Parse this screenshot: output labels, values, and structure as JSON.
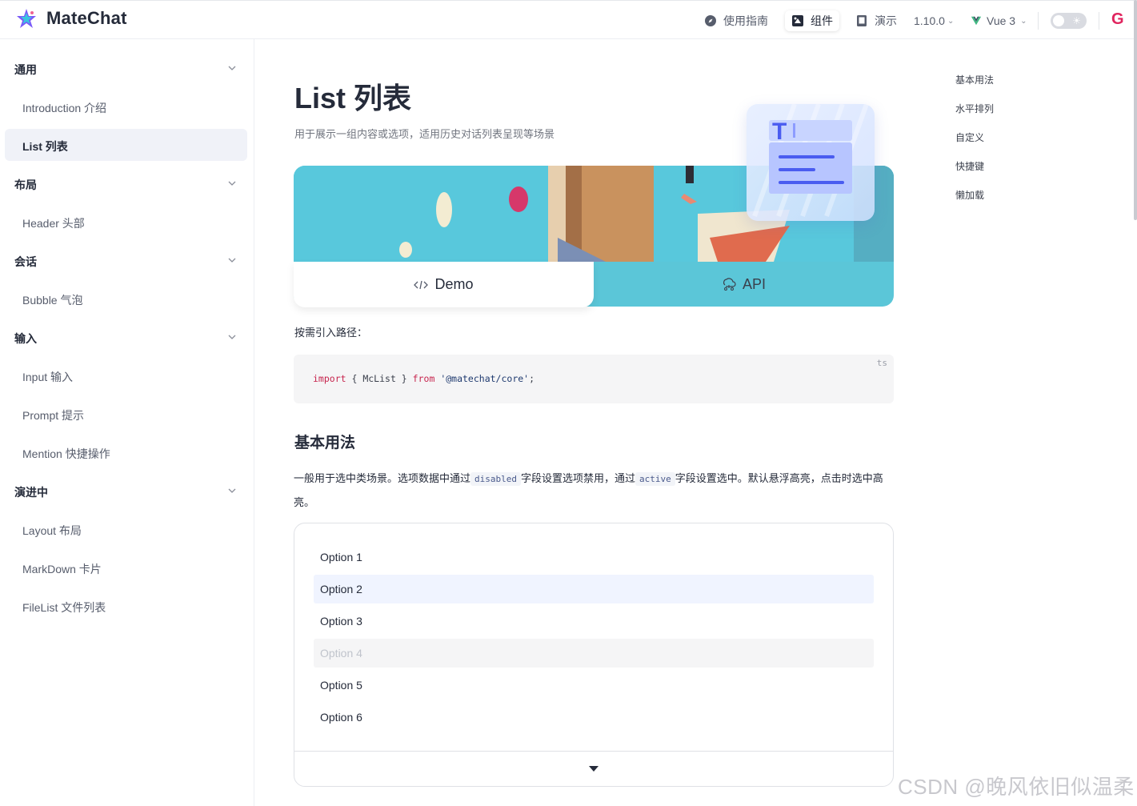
{
  "header": {
    "brand": "MateChat",
    "nav": [
      {
        "label": "使用指南",
        "icon": "compass-icon"
      },
      {
        "label": "组件",
        "icon": "component-icon",
        "active": true
      },
      {
        "label": "演示",
        "icon": "book-icon"
      }
    ],
    "version": "1.10.0",
    "framework": "Vue 3",
    "accent": "#5e7ce0"
  },
  "sidebar": {
    "groups": [
      {
        "label": "通用",
        "items": [
          "Introduction 介绍",
          "List 列表"
        ]
      },
      {
        "label": "布局",
        "items": [
          "Header 头部"
        ]
      },
      {
        "label": "会话",
        "items": [
          "Bubble 气泡"
        ]
      },
      {
        "label": "输入",
        "items": [
          "Input 输入",
          "Prompt 提示",
          "Mention 快捷操作"
        ]
      },
      {
        "label": "演进中",
        "items": [
          "Layout 布局",
          "MarkDown 卡片",
          "FileList 文件列表"
        ]
      }
    ],
    "active_item": "List 列表"
  },
  "main": {
    "title": "List 列表",
    "description": "用于展示一组内容或选项，适用历史对话列表呈现等场景",
    "tabs": {
      "demo": "Demo",
      "api": "API"
    },
    "import_label": "按需引入路径：",
    "code": {
      "lang": "ts",
      "kw_import": "import",
      "braces": "{ McList }",
      "kw_from": "from",
      "module": "'@matechat/core'",
      "semicolon": ";"
    },
    "section_title": "基本用法",
    "section_desc": {
      "part1": "一般用于选中类场景。选项数据中通过",
      "code1": "disabled",
      "part2": "字段设置选项禁用，通过",
      "code2": "active",
      "part3": "字段设置选中。默认悬浮高亮，点击时选中高亮。"
    },
    "options": [
      {
        "label": "Option 1",
        "state": "normal"
      },
      {
        "label": "Option 2",
        "state": "active"
      },
      {
        "label": "Option 3",
        "state": "normal"
      },
      {
        "label": "Option 4",
        "state": "disabled"
      },
      {
        "label": "Option 5",
        "state": "normal"
      },
      {
        "label": "Option 6",
        "state": "normal"
      }
    ]
  },
  "toc": [
    "基本用法",
    "水平排列",
    "自定义",
    "快捷键",
    "懒加载"
  ],
  "watermark": "CSDN @晚风依旧似温柔"
}
